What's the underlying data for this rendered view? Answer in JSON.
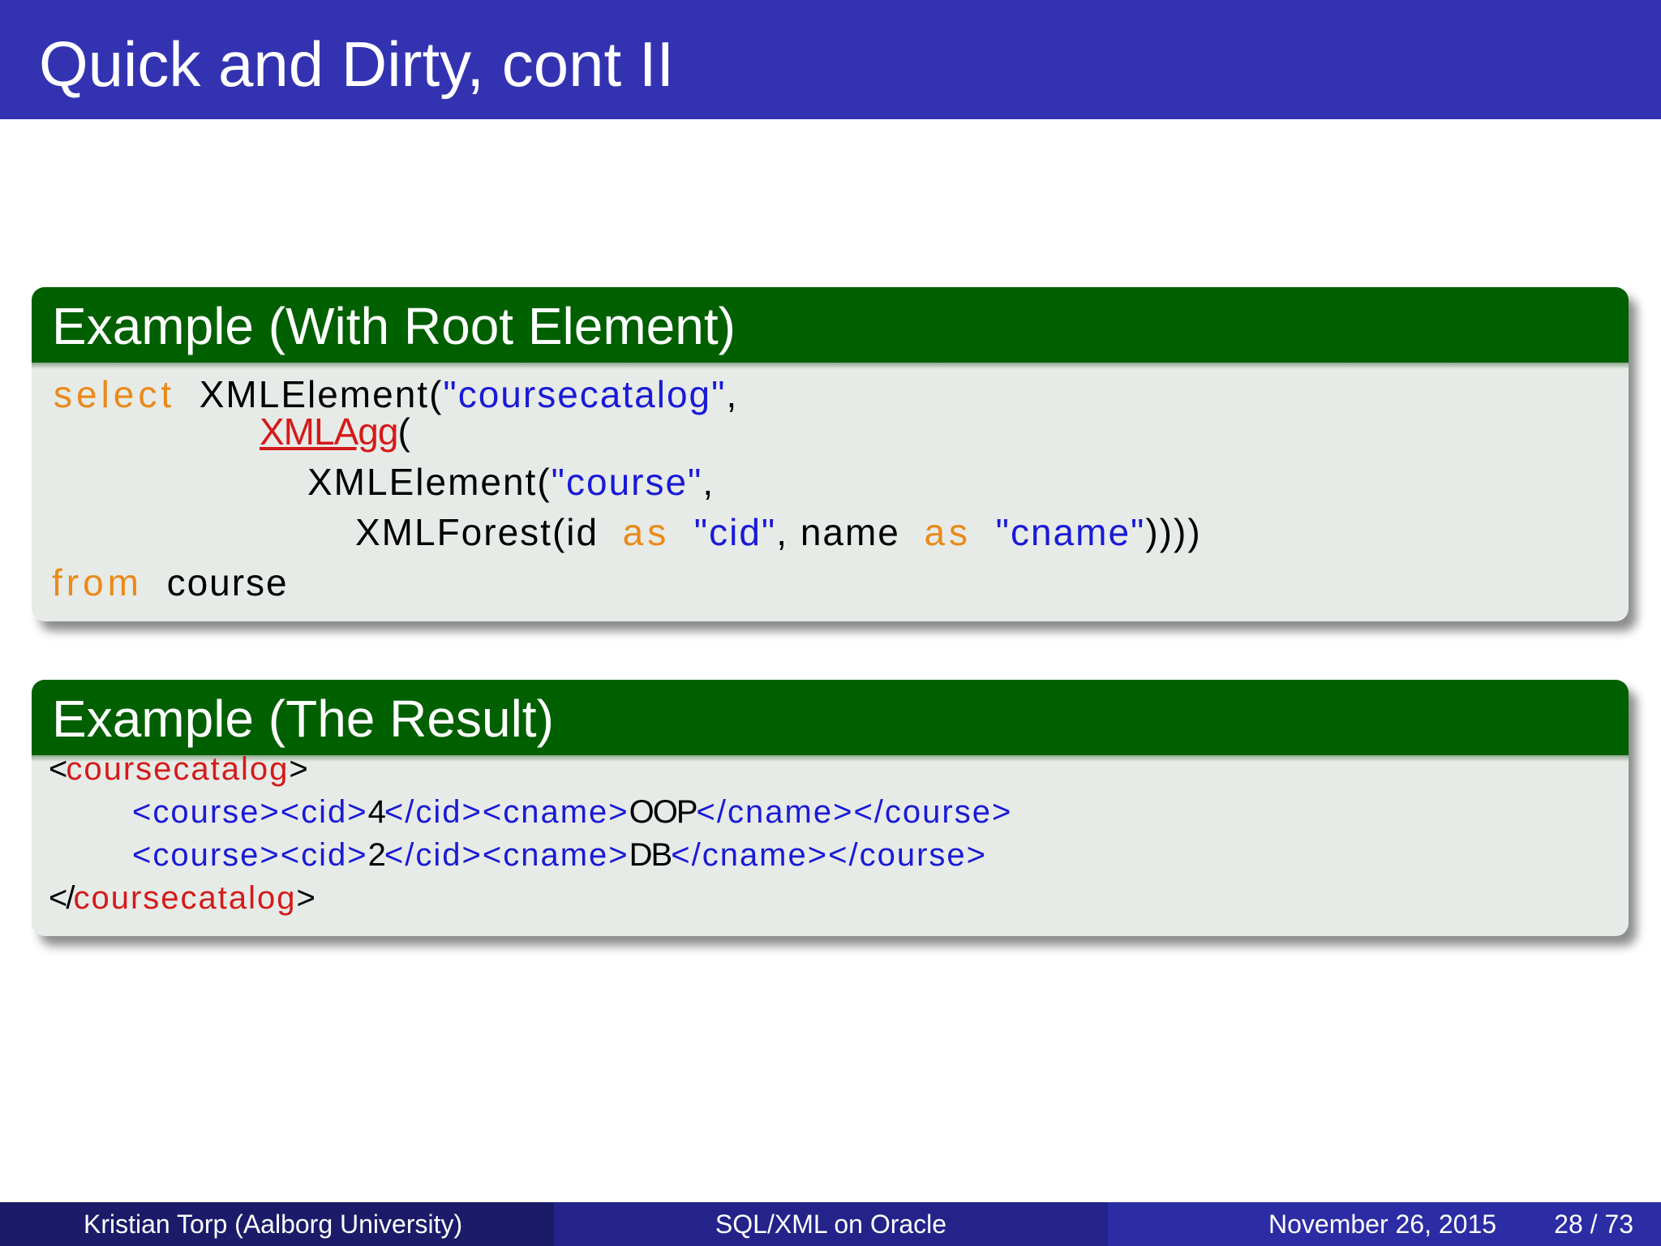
{
  "slide": {
    "title": "Quick and Dirty, cont II"
  },
  "block1": {
    "title": "Example (With Root Element)",
    "code": {
      "l1": {
        "kw": "select",
        "fn": "XMLElement(",
        "str": "\"coursecatalog\"",
        "tail": ","
      },
      "l2": {
        "hl": "XMLAgg",
        "tail": "("
      },
      "l3": {
        "fn": "XMLElement(",
        "str": "\"course\"",
        "tail": ","
      },
      "l4": {
        "fn": "XMLForest(id",
        "kw1": "as",
        "str1": "\"cid\"",
        "mid": ",  name",
        "kw2": "as",
        "str2": "\"cname\"",
        "tail": "))))"
      },
      "l5": {
        "kw": "from",
        "fn": "course"
      }
    }
  },
  "block2": {
    "title": "Example (The Result)",
    "result": {
      "l1": {
        "open": "<",
        "name": "coursecatalog",
        "close": ">"
      },
      "l2": {
        "a": "<course><cid>",
        "v1": "4",
        "b": "</cid><cname>",
        "v2": "OOP",
        "c": "</cname></course>"
      },
      "l3": {
        "a": "<course><cid>",
        "v1": "2",
        "b": "</cid><cname>",
        "v2": "DB",
        "c": "</cname></course>"
      },
      "l4": {
        "open": "</",
        "name": "coursecatalog",
        "close": ">"
      }
    }
  },
  "footer": {
    "author": "Kristian Torp  (Aalborg University)",
    "topic": "SQL/XML on Oracle",
    "date": "November 26, 2015",
    "page": "28 / 73"
  },
  "colors": {
    "title_bar": "#3333b2",
    "block_header": "#006000",
    "keyword": "#ea8a1a",
    "string": "#1a1ad6",
    "highlight": "#d41a1a"
  }
}
